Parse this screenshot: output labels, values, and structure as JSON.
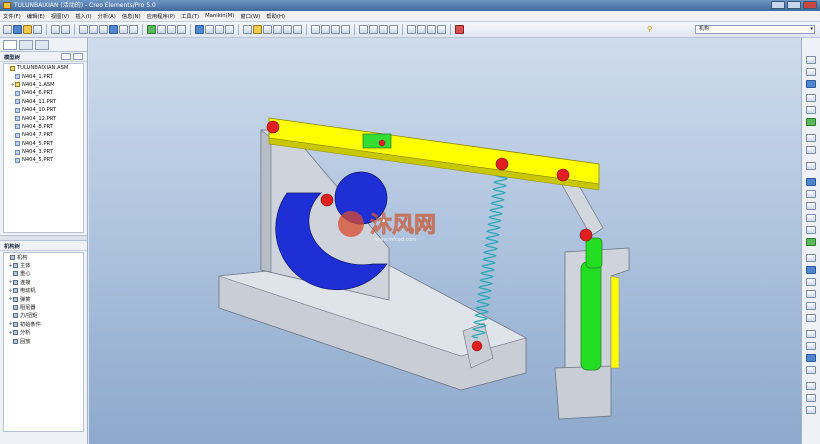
{
  "window": {
    "title": "TULUNBAIXIAN (活动的) - Creo Elements/Pro 5.0"
  },
  "menu": [
    "文件(F)",
    "编辑(E)",
    "视图(V)",
    "插入(I)",
    "分析(A)",
    "信息(N)",
    "应用程序(P)",
    "工具(T)",
    "Manikin(M)",
    "窗口(W)",
    "帮助(H)"
  ],
  "toolbar": {
    "filter_value": "机构"
  },
  "model_tree": {
    "header": "模型树",
    "items": [
      {
        "label": "TULUNBAIXIAN.ASM",
        "kind": "asm",
        "expand": ""
      },
      {
        "label": "N404_1.PRT",
        "kind": "prt",
        "expand": ""
      },
      {
        "label": "N404_1.ASM",
        "kind": "asm",
        "expand": "+"
      },
      {
        "label": "N404_6.PRT",
        "kind": "prt",
        "expand": ""
      },
      {
        "label": "N404_11.PRT",
        "kind": "prt",
        "expand": ""
      },
      {
        "label": "N404_10.PRT",
        "kind": "prt",
        "expand": ""
      },
      {
        "label": "N404_12.PRT",
        "kind": "prt",
        "expand": ""
      },
      {
        "label": "N404_8.PRT",
        "kind": "prt",
        "expand": ""
      },
      {
        "label": "N404_7.PRT",
        "kind": "prt",
        "expand": ""
      },
      {
        "label": "N404_5.PRT",
        "kind": "prt",
        "expand": ""
      },
      {
        "label": "N404_3.PRT",
        "kind": "prt",
        "expand": ""
      },
      {
        "label": "N404_5.PRT",
        "kind": "prt",
        "expand": ""
      }
    ]
  },
  "mech_tree": {
    "header": "机构树",
    "items": [
      {
        "label": "机构",
        "expand": ""
      },
      {
        "label": "主体",
        "expand": "+"
      },
      {
        "label": "重心",
        "expand": ""
      },
      {
        "label": "连接",
        "expand": "+"
      },
      {
        "label": "电动机",
        "expand": "+"
      },
      {
        "label": "弹簧",
        "expand": "+"
      },
      {
        "label": "阻尼器",
        "expand": ""
      },
      {
        "label": "力/扭矩",
        "expand": ""
      },
      {
        "label": "初始条件",
        "expand": "+"
      },
      {
        "label": "分析",
        "expand": "+"
      },
      {
        "label": "回放",
        "expand": ""
      }
    ]
  },
  "watermark": {
    "brand": "沐风网",
    "url": "www.mfcad.com"
  },
  "colors": {
    "beam": "#ffff00",
    "cam": "#1e2fd6",
    "pin": "#e02020",
    "slider": "#22dd22",
    "spring": "#27a6b5",
    "base": "#c9ced6"
  }
}
